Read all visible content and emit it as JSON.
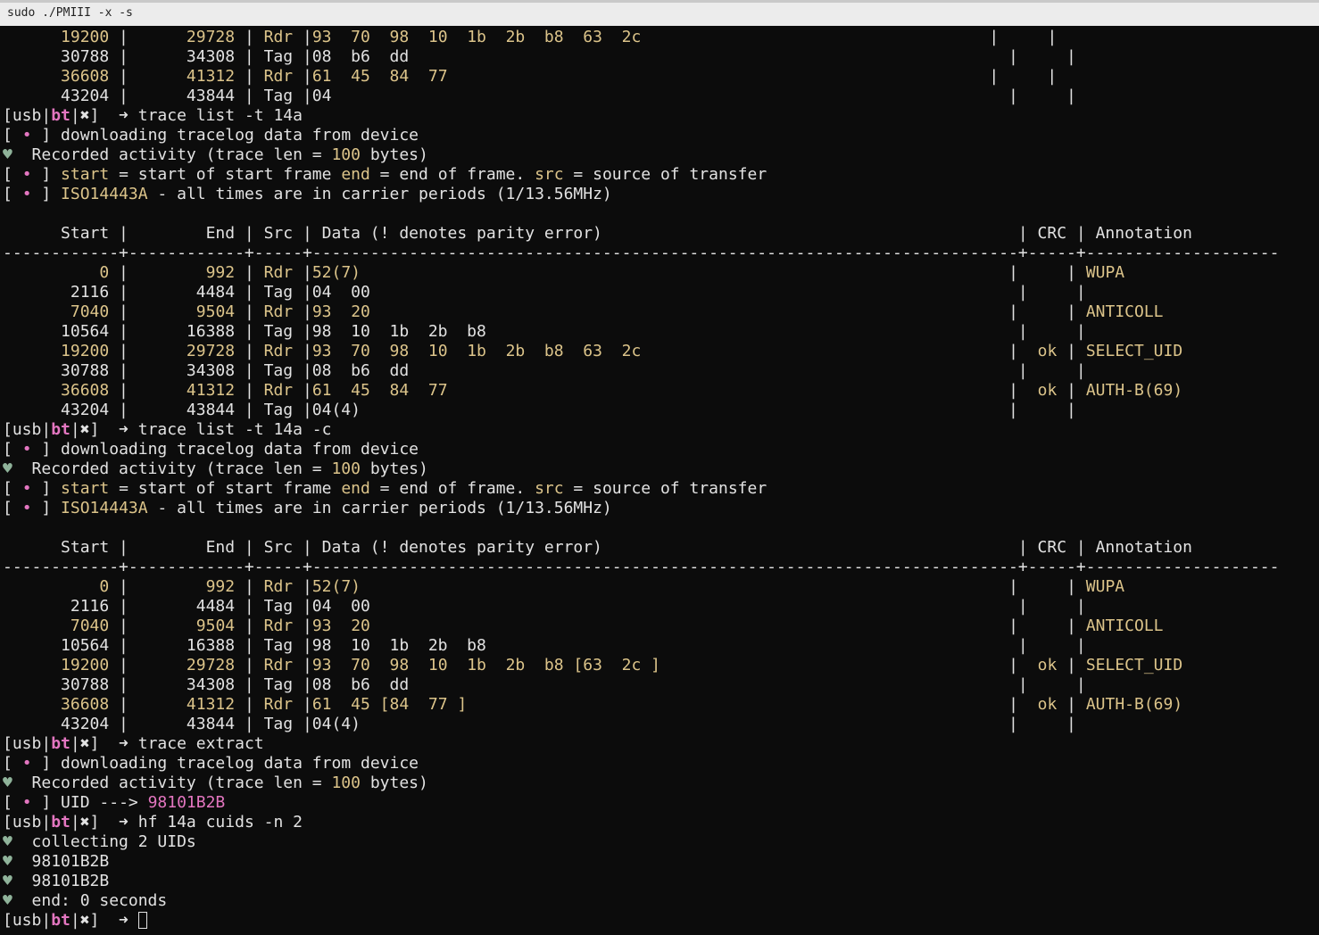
{
  "window": {
    "title": "sudo ./PMIII -x -s"
  },
  "prompt": {
    "open": "[usb|",
    "bt": "bt",
    "sep": "|",
    "x": "✖",
    "close": "]",
    "arrow": "  ➜ "
  },
  "lines": [
    [
      [
        "y",
        "      19200"
      ],
      [
        "w",
        " |      "
      ],
      [
        "y",
        "29728"
      ],
      [
        "w",
        " | "
      ],
      [
        "y",
        "Rdr"
      ],
      [
        "w",
        " |"
      ],
      [
        "y",
        "93  70  98  10  1b  2b  b8  63  2c"
      ],
      [
        "w",
        "                                    |     |"
      ]
    ],
    [
      [
        "w",
        "      30788 |      34308 | Tag |08  b6  dd                                                              |     |"
      ]
    ],
    [
      [
        "y",
        "      36608"
      ],
      [
        "w",
        " |      "
      ],
      [
        "y",
        "41312"
      ],
      [
        "w",
        " | "
      ],
      [
        "y",
        "Rdr"
      ],
      [
        "w",
        " |"
      ],
      [
        "y",
        "61  45  84  77"
      ],
      [
        "w",
        "                                                        |     |"
      ]
    ],
    [
      [
        "w",
        "      43204 |      43844 | Tag |04                                                                      |     |"
      ]
    ],
    [
      [
        "w",
        "[usb|"
      ],
      [
        "mb",
        "bt"
      ],
      [
        "w",
        "|✖]  ➜ trace list -t 14a"
      ]
    ],
    [
      [
        "w",
        "[ "
      ],
      [
        "m",
        "•"
      ],
      [
        "w",
        " ] downloading tracelog data from device"
      ]
    ],
    [
      [
        "g",
        "♥"
      ],
      [
        "w",
        "  Recorded activity (trace len = "
      ],
      [
        "y",
        "100"
      ],
      [
        "w",
        " bytes)"
      ]
    ],
    [
      [
        "w",
        "[ "
      ],
      [
        "m",
        "•"
      ],
      [
        "w",
        " ] "
      ],
      [
        "y",
        "start"
      ],
      [
        "w",
        " = start of start frame "
      ],
      [
        "y",
        "end"
      ],
      [
        "w",
        " = end of frame. "
      ],
      [
        "y",
        "src"
      ],
      [
        "w",
        " = source of transfer"
      ]
    ],
    [
      [
        "w",
        "[ "
      ],
      [
        "m",
        "•"
      ],
      [
        "w",
        " ] "
      ],
      [
        "y",
        "ISO14443A"
      ],
      [
        "w",
        " - all times are in carrier periods (1/13.56MHz)"
      ]
    ],
    [
      [
        "w",
        ""
      ]
    ],
    [
      [
        "w",
        "      Start |        End | Src | Data (! denotes parity error)                                           | CRC | Annotation"
      ]
    ],
    [
      [
        "w",
        "------------+------------+-----+-------------------------------------------------------------------------+-----+--------------------"
      ]
    ],
    [
      [
        "y",
        "          0"
      ],
      [
        "w",
        " |        "
      ],
      [
        "y",
        "992"
      ],
      [
        "w",
        " | "
      ],
      [
        "y",
        "Rdr"
      ],
      [
        "w",
        " |"
      ],
      [
        "y",
        "52(7)"
      ],
      [
        "w",
        "                                                                   |     | "
      ],
      [
        "y",
        "WUPA"
      ]
    ],
    [
      [
        "w",
        "       2116 |       4484 | Tag |04  00                                                                   |     |"
      ]
    ],
    [
      [
        "y",
        "       7040"
      ],
      [
        "w",
        " |       "
      ],
      [
        "y",
        "9504"
      ],
      [
        "w",
        " | "
      ],
      [
        "y",
        "Rdr"
      ],
      [
        "w",
        " |"
      ],
      [
        "y",
        "93  20"
      ],
      [
        "w",
        "                                                                  |     | "
      ],
      [
        "y",
        "ANTICOLL"
      ]
    ],
    [
      [
        "w",
        "      10564 |      16388 | Tag |98  10  1b  2b  b8                                                       |     |"
      ]
    ],
    [
      [
        "y",
        "      19200"
      ],
      [
        "w",
        " |      "
      ],
      [
        "y",
        "29728"
      ],
      [
        "w",
        " | "
      ],
      [
        "y",
        "Rdr"
      ],
      [
        "w",
        " |"
      ],
      [
        "y",
        "93  70  98  10  1b  2b  b8  63  2c"
      ],
      [
        "w",
        "                                      |  "
      ],
      [
        "y",
        "ok"
      ],
      [
        "w",
        " | "
      ],
      [
        "y",
        "SELECT_UID"
      ]
    ],
    [
      [
        "w",
        "      30788 |      34308 | Tag |08  b6  dd                                                               |     |"
      ]
    ],
    [
      [
        "y",
        "      36608"
      ],
      [
        "w",
        " |      "
      ],
      [
        "y",
        "41312"
      ],
      [
        "w",
        " | "
      ],
      [
        "y",
        "Rdr"
      ],
      [
        "w",
        " |"
      ],
      [
        "y",
        "61  45  84  77"
      ],
      [
        "w",
        "                                                          |  "
      ],
      [
        "y",
        "ok"
      ],
      [
        "w",
        " | "
      ],
      [
        "y",
        "AUTH-B(69)"
      ]
    ],
    [
      [
        "w",
        "      43204 |      43844 | Tag |04(4)                                                                   |     |"
      ]
    ],
    [
      [
        "w",
        "[usb|"
      ],
      [
        "mb",
        "bt"
      ],
      [
        "w",
        "|✖]  ➜ trace list -t 14a -c"
      ]
    ],
    [
      [
        "w",
        "[ "
      ],
      [
        "m",
        "•"
      ],
      [
        "w",
        " ] downloading tracelog data from device"
      ]
    ],
    [
      [
        "g",
        "♥"
      ],
      [
        "w",
        "  Recorded activity (trace len = "
      ],
      [
        "y",
        "100"
      ],
      [
        "w",
        " bytes)"
      ]
    ],
    [
      [
        "w",
        "[ "
      ],
      [
        "m",
        "•"
      ],
      [
        "w",
        " ] "
      ],
      [
        "y",
        "start"
      ],
      [
        "w",
        " = start of start frame "
      ],
      [
        "y",
        "end"
      ],
      [
        "w",
        " = end of frame. "
      ],
      [
        "y",
        "src"
      ],
      [
        "w",
        " = source of transfer"
      ]
    ],
    [
      [
        "w",
        "[ "
      ],
      [
        "m",
        "•"
      ],
      [
        "w",
        " ] "
      ],
      [
        "y",
        "ISO14443A"
      ],
      [
        "w",
        " - all times are in carrier periods (1/13.56MHz)"
      ]
    ],
    [
      [
        "w",
        ""
      ]
    ],
    [
      [
        "w",
        "      Start |        End | Src | Data (! denotes parity error)                                           | CRC | Annotation"
      ]
    ],
    [
      [
        "w",
        "------------+------------+-----+-------------------------------------------------------------------------+-----+--------------------"
      ]
    ],
    [
      [
        "y",
        "          0"
      ],
      [
        "w",
        " |        "
      ],
      [
        "y",
        "992"
      ],
      [
        "w",
        " | "
      ],
      [
        "y",
        "Rdr"
      ],
      [
        "w",
        " |"
      ],
      [
        "y",
        "52(7)"
      ],
      [
        "w",
        "                                                                   |     | "
      ],
      [
        "y",
        "WUPA"
      ]
    ],
    [
      [
        "w",
        "       2116 |       4484 | Tag |04  00                                                                   |     |"
      ]
    ],
    [
      [
        "y",
        "       7040"
      ],
      [
        "w",
        " |       "
      ],
      [
        "y",
        "9504"
      ],
      [
        "w",
        " | "
      ],
      [
        "y",
        "Rdr"
      ],
      [
        "w",
        " |"
      ],
      [
        "y",
        "93  20"
      ],
      [
        "w",
        "                                                                  |     | "
      ],
      [
        "y",
        "ANTICOLL"
      ]
    ],
    [
      [
        "w",
        "      10564 |      16388 | Tag |98  10  1b  2b  b8                                                       |     |"
      ]
    ],
    [
      [
        "y",
        "      19200"
      ],
      [
        "w",
        " |      "
      ],
      [
        "y",
        "29728"
      ],
      [
        "w",
        " | "
      ],
      [
        "y",
        "Rdr"
      ],
      [
        "w",
        " |"
      ],
      [
        "y",
        "93  70  98  10  1b  2b  b8 [63  2c ]"
      ],
      [
        "w",
        "                                    |  "
      ],
      [
        "y",
        "ok"
      ],
      [
        "w",
        " | "
      ],
      [
        "y",
        "SELECT_UID"
      ]
    ],
    [
      [
        "w",
        "      30788 |      34308 | Tag |08  b6  dd                                                               |     |"
      ]
    ],
    [
      [
        "y",
        "      36608"
      ],
      [
        "w",
        " |      "
      ],
      [
        "y",
        "41312"
      ],
      [
        "w",
        " | "
      ],
      [
        "y",
        "Rdr"
      ],
      [
        "w",
        " |"
      ],
      [
        "y",
        "61  45 [84  77 ]"
      ],
      [
        "w",
        "                                                        |  "
      ],
      [
        "y",
        "ok"
      ],
      [
        "w",
        " | "
      ],
      [
        "y",
        "AUTH-B(69)"
      ]
    ],
    [
      [
        "w",
        "      43204 |      43844 | Tag |04(4)                                                                   |     |"
      ]
    ],
    [
      [
        "w",
        "[usb|"
      ],
      [
        "mb",
        "bt"
      ],
      [
        "w",
        "|✖]  ➜ trace extract"
      ]
    ],
    [
      [
        "w",
        "[ "
      ],
      [
        "m",
        "•"
      ],
      [
        "w",
        " ] downloading tracelog data from device"
      ]
    ],
    [
      [
        "g",
        "♥"
      ],
      [
        "w",
        "  Recorded activity (trace len = "
      ],
      [
        "y",
        "100"
      ],
      [
        "w",
        " bytes)"
      ]
    ],
    [
      [
        "w",
        "[ "
      ],
      [
        "m",
        "•"
      ],
      [
        "w",
        " ] UID ---> "
      ],
      [
        "m",
        "98101B2B"
      ]
    ],
    [
      [
        "w",
        "[usb|"
      ],
      [
        "mb",
        "bt"
      ],
      [
        "w",
        "|✖]  ➜ hf 14a cuids -n 2"
      ]
    ],
    [
      [
        "g",
        "♥"
      ],
      [
        "w",
        "  collecting 2 UIDs"
      ]
    ],
    [
      [
        "g",
        "♥"
      ],
      [
        "w",
        "  98101B2B"
      ]
    ],
    [
      [
        "g",
        "♥"
      ],
      [
        "w",
        "  98101B2B"
      ]
    ],
    [
      [
        "g",
        "♥"
      ],
      [
        "w",
        "  end: 0 seconds"
      ]
    ]
  ],
  "input_line": {
    "open": "[usb|",
    "bt": "bt",
    "rest": "|✖]  ➜ ",
    "value": ""
  }
}
